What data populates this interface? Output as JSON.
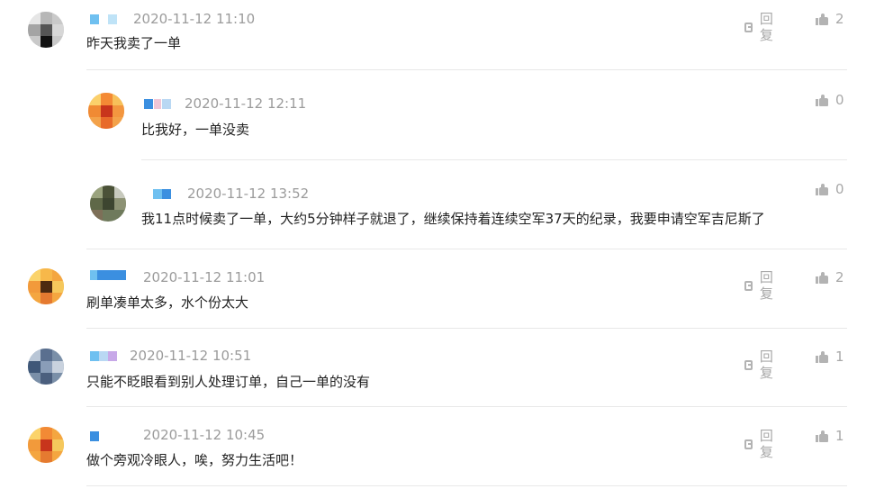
{
  "comments": [
    {
      "time": "2020-11-12 11:10",
      "text": "昨天我卖了一单",
      "reply": "回复",
      "likes": "2"
    },
    {
      "time": "2020-11-12 12:11",
      "text": "比我好，一单没卖",
      "likes": "0"
    },
    {
      "time": "2020-11-12 13:52",
      "text": "我11点时候卖了一单，大约5分钟样子就退了，继续保持着连续空军37天的纪录，我要申请空军吉尼斯了",
      "likes": "0"
    },
    {
      "time": "2020-11-12 11:01",
      "text": "刷单凑单太多，水个份太大",
      "reply": "回复",
      "likes": "2"
    },
    {
      "time": "2020-11-12 10:51",
      "text": "只能不眨眼看到别人处理订单，自己一单的没有",
      "reply": "回复",
      "likes": "1"
    },
    {
      "time": "2020-11-12 10:45",
      "text": "做个旁观冷眼人，唉，努力生活吧！",
      "reply": "回复",
      "likes": "1"
    }
  ],
  "colors": {
    "timestamp": "#9b9b9b",
    "action": "#a8a8a8",
    "divider": "#e8e8e8",
    "username_blue": "#3b8fe0"
  },
  "icons": {
    "reply": "comment-icon",
    "like": "thumbs-up-icon"
  }
}
